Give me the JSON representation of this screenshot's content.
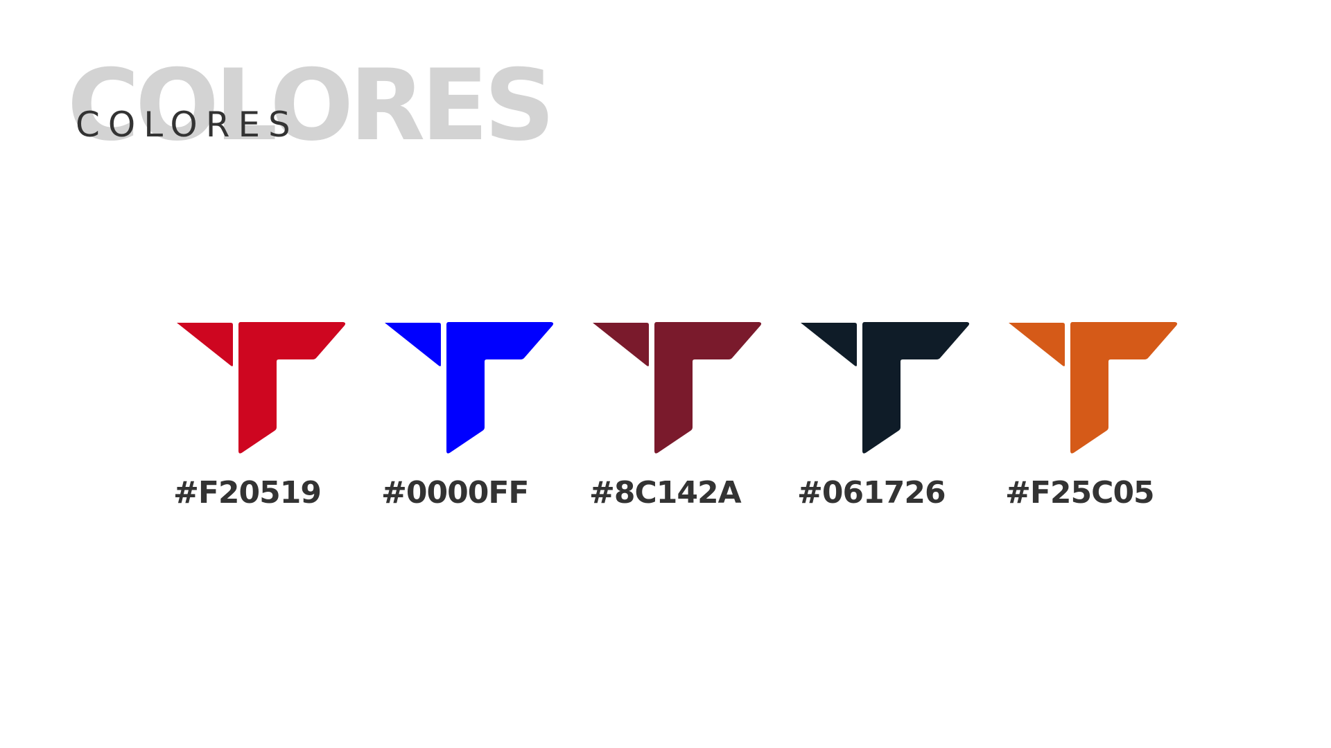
{
  "header": {
    "title_bg": "COLORES",
    "title": "COLORES"
  },
  "swatches": [
    {
      "label": "#F20519",
      "color": "#CE0620"
    },
    {
      "label": "#0000FF",
      "color": "#0000FF"
    },
    {
      "label": "#8C142A",
      "color": "#7A1A2C"
    },
    {
      "label": "#061726",
      "color": "#0F1C28"
    },
    {
      "label": "#F25C05",
      "color": "#D55A18"
    }
  ]
}
